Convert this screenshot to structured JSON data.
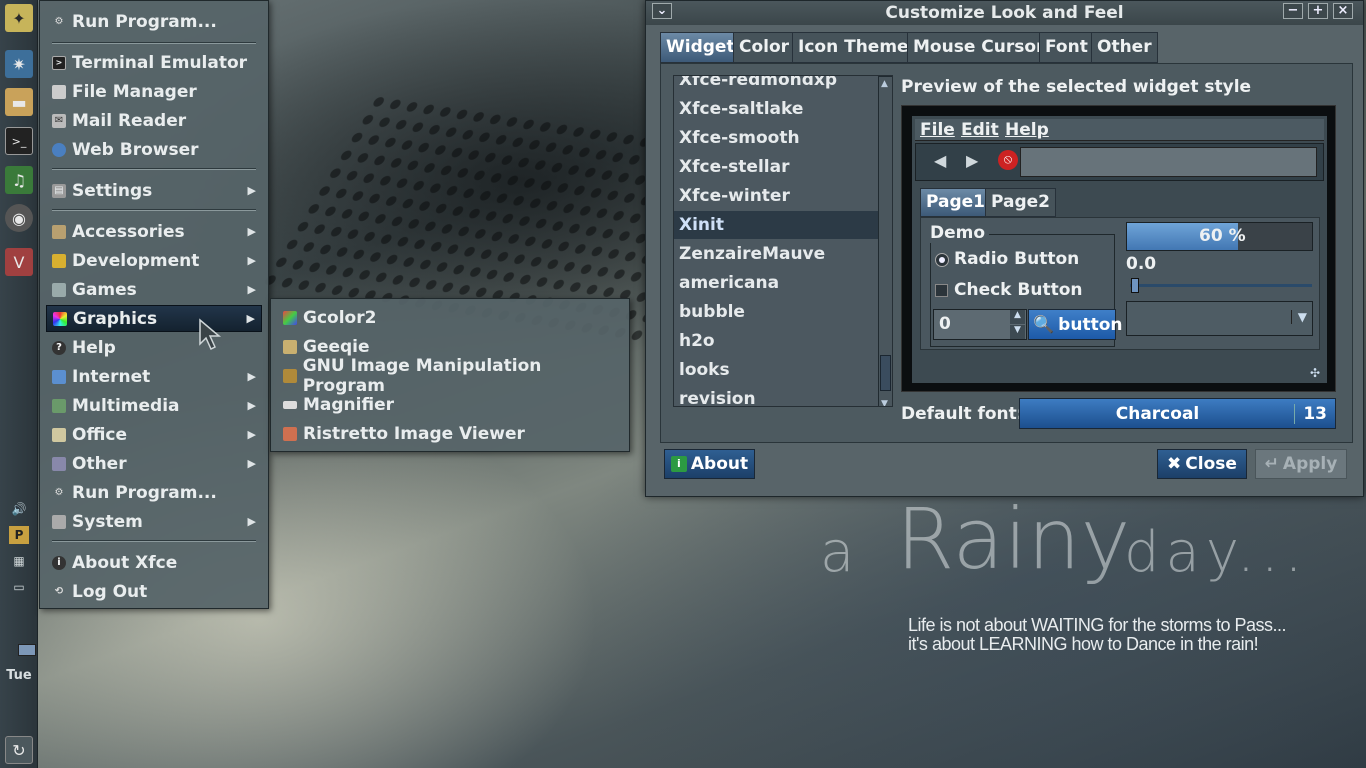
{
  "wallpaper": {
    "title_word_a": "a",
    "title_word_rainy": "Rainy",
    "title_word_day": "day...",
    "quote_line1": "Life is not about WAITING for the storms to Pass...",
    "quote_line2": "it's about LEARNING how to Dance in the rain!"
  },
  "panel": {
    "day": "Tue",
    "launchers": [
      "xfce-mouse-icon",
      "screenshot-icon",
      "folder-icon",
      "terminal-icon",
      "music-icon",
      "camera-icon",
      "vivaldi-icon"
    ]
  },
  "app_menu": {
    "items": [
      {
        "label": "Run Program...",
        "icon": "gear-icon"
      },
      {
        "label": "Terminal Emulator",
        "icon": "terminal-icon"
      },
      {
        "label": "File Manager",
        "icon": "file-manager-icon"
      },
      {
        "label": "Mail Reader",
        "icon": "mail-icon"
      },
      {
        "label": "Web Browser",
        "icon": "globe-icon"
      },
      {
        "label": "Settings",
        "icon": "settings-icon"
      },
      {
        "label": "Accessories",
        "icon": "accessories-icon"
      },
      {
        "label": "Development",
        "icon": "development-icon"
      },
      {
        "label": "Games",
        "icon": "games-icon"
      },
      {
        "label": "Graphics",
        "icon": "graphics-icon"
      },
      {
        "label": "Help",
        "icon": "help-icon"
      },
      {
        "label": "Internet",
        "icon": "internet-icon"
      },
      {
        "label": "Multimedia",
        "icon": "multimedia-icon"
      },
      {
        "label": "Office",
        "icon": "office-icon"
      },
      {
        "label": "Other",
        "icon": "other-icon"
      },
      {
        "label": "Run Program...",
        "icon": "gear-icon"
      },
      {
        "label": "System",
        "icon": "system-icon"
      },
      {
        "label": "About Xfce",
        "icon": "info-icon"
      },
      {
        "label": "Log Out",
        "icon": "logout-icon"
      }
    ]
  },
  "graphics_submenu": {
    "items": [
      {
        "label": "Gcolor2"
      },
      {
        "label": "Geeqie"
      },
      {
        "label": "GNU Image Manipulation Program"
      },
      {
        "label": "Magnifier"
      },
      {
        "label": "Ristretto Image Viewer"
      }
    ]
  },
  "dialog": {
    "title": "Customize Look and Feel",
    "tabs": [
      "Widget",
      "Color",
      "Icon Theme",
      "Mouse Cursor",
      "Font",
      "Other"
    ],
    "themes": [
      "Xfce-redmondxp",
      "Xfce-saltlake",
      "Xfce-smooth",
      "Xfce-stellar",
      "Xfce-winter",
      "Xinit",
      "ZenzaireMauve",
      "americana",
      "bubble",
      "h2o",
      "looks",
      "revision"
    ],
    "selected_theme": "Xinit",
    "preview_label": "Preview of the selected widget style",
    "preview": {
      "menu": [
        "File",
        "Edit",
        "Help"
      ],
      "tabs": [
        "Page1",
        "Page2"
      ],
      "frame_label": "Demo",
      "radio_label": "Radio Button",
      "check_label": "Check Button",
      "spin_value": "0",
      "button_label": "button",
      "progress_text": "60 %",
      "progress_value": 0.6,
      "scale_value": "0.0"
    },
    "default_font_label": "Default font:",
    "font_name": "Charcoal",
    "font_size": "13",
    "about_label": "About",
    "close_label": "Close",
    "apply_label": "Apply"
  }
}
